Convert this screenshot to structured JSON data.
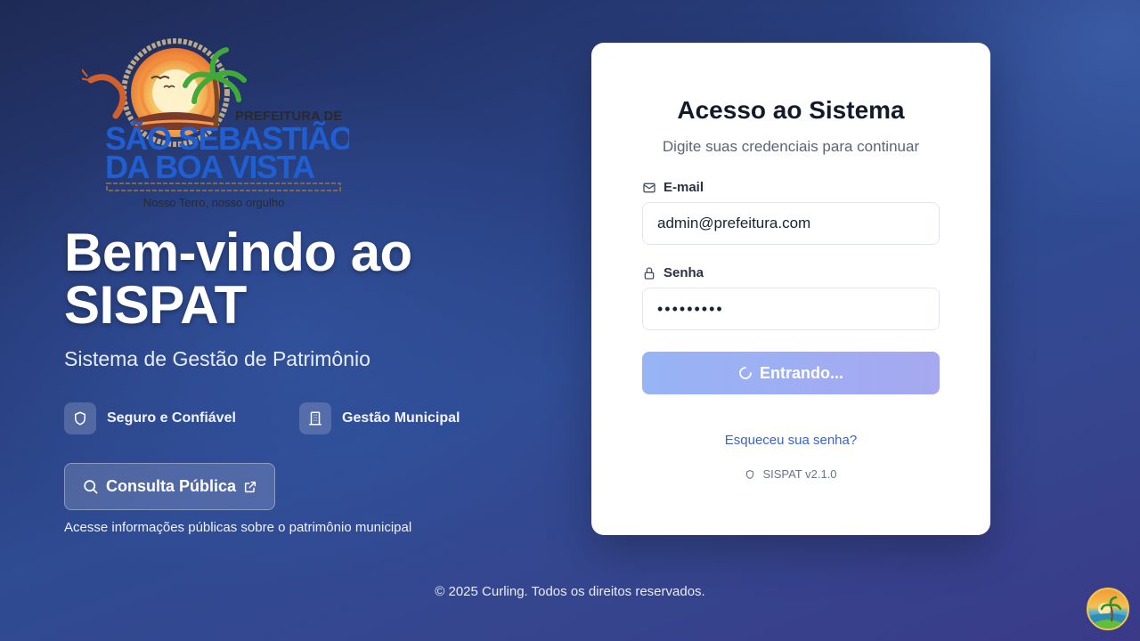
{
  "logo": {
    "org_line": "PREFEITURA DE",
    "city_line_1": "SÃO SEBASTIÃO",
    "city_line_2": "DA BOA VISTA",
    "motto": "Nosso Terro, nosso orgulho"
  },
  "hero": {
    "title": "Bem-vindo ao SISPAT",
    "subtitle": "Sistema de Gestão de Patrimônio"
  },
  "features": [
    {
      "label": "Seguro e Confiável",
      "icon": "shield-icon"
    },
    {
      "label": "Gestão Municipal",
      "icon": "building-icon"
    }
  ],
  "public_access": {
    "button_label": "Consulta Pública",
    "note": "Acesse informações públicas sobre o patrimônio municipal"
  },
  "login": {
    "title": "Acesso ao Sistema",
    "subtitle": "Digite suas credenciais para continuar",
    "email_label": "E-mail",
    "email_value": "admin@prefeitura.com",
    "password_label": "Senha",
    "password_value": "•••••••••",
    "submit_label": "Entrando...",
    "forgot_label": "Esqueceu sua senha?",
    "version": "SISPAT v2.1.0"
  },
  "footer": {
    "copyright": "© 2025 Curling. Todos os direitos reservados."
  },
  "colors": {
    "background_start": "#1e2a55",
    "background_end": "#3a3a88",
    "card": "#ffffff",
    "button_gradient_start": "#97b4f5",
    "button_gradient_end": "#a6a8f0",
    "link": "#3a64c8"
  }
}
